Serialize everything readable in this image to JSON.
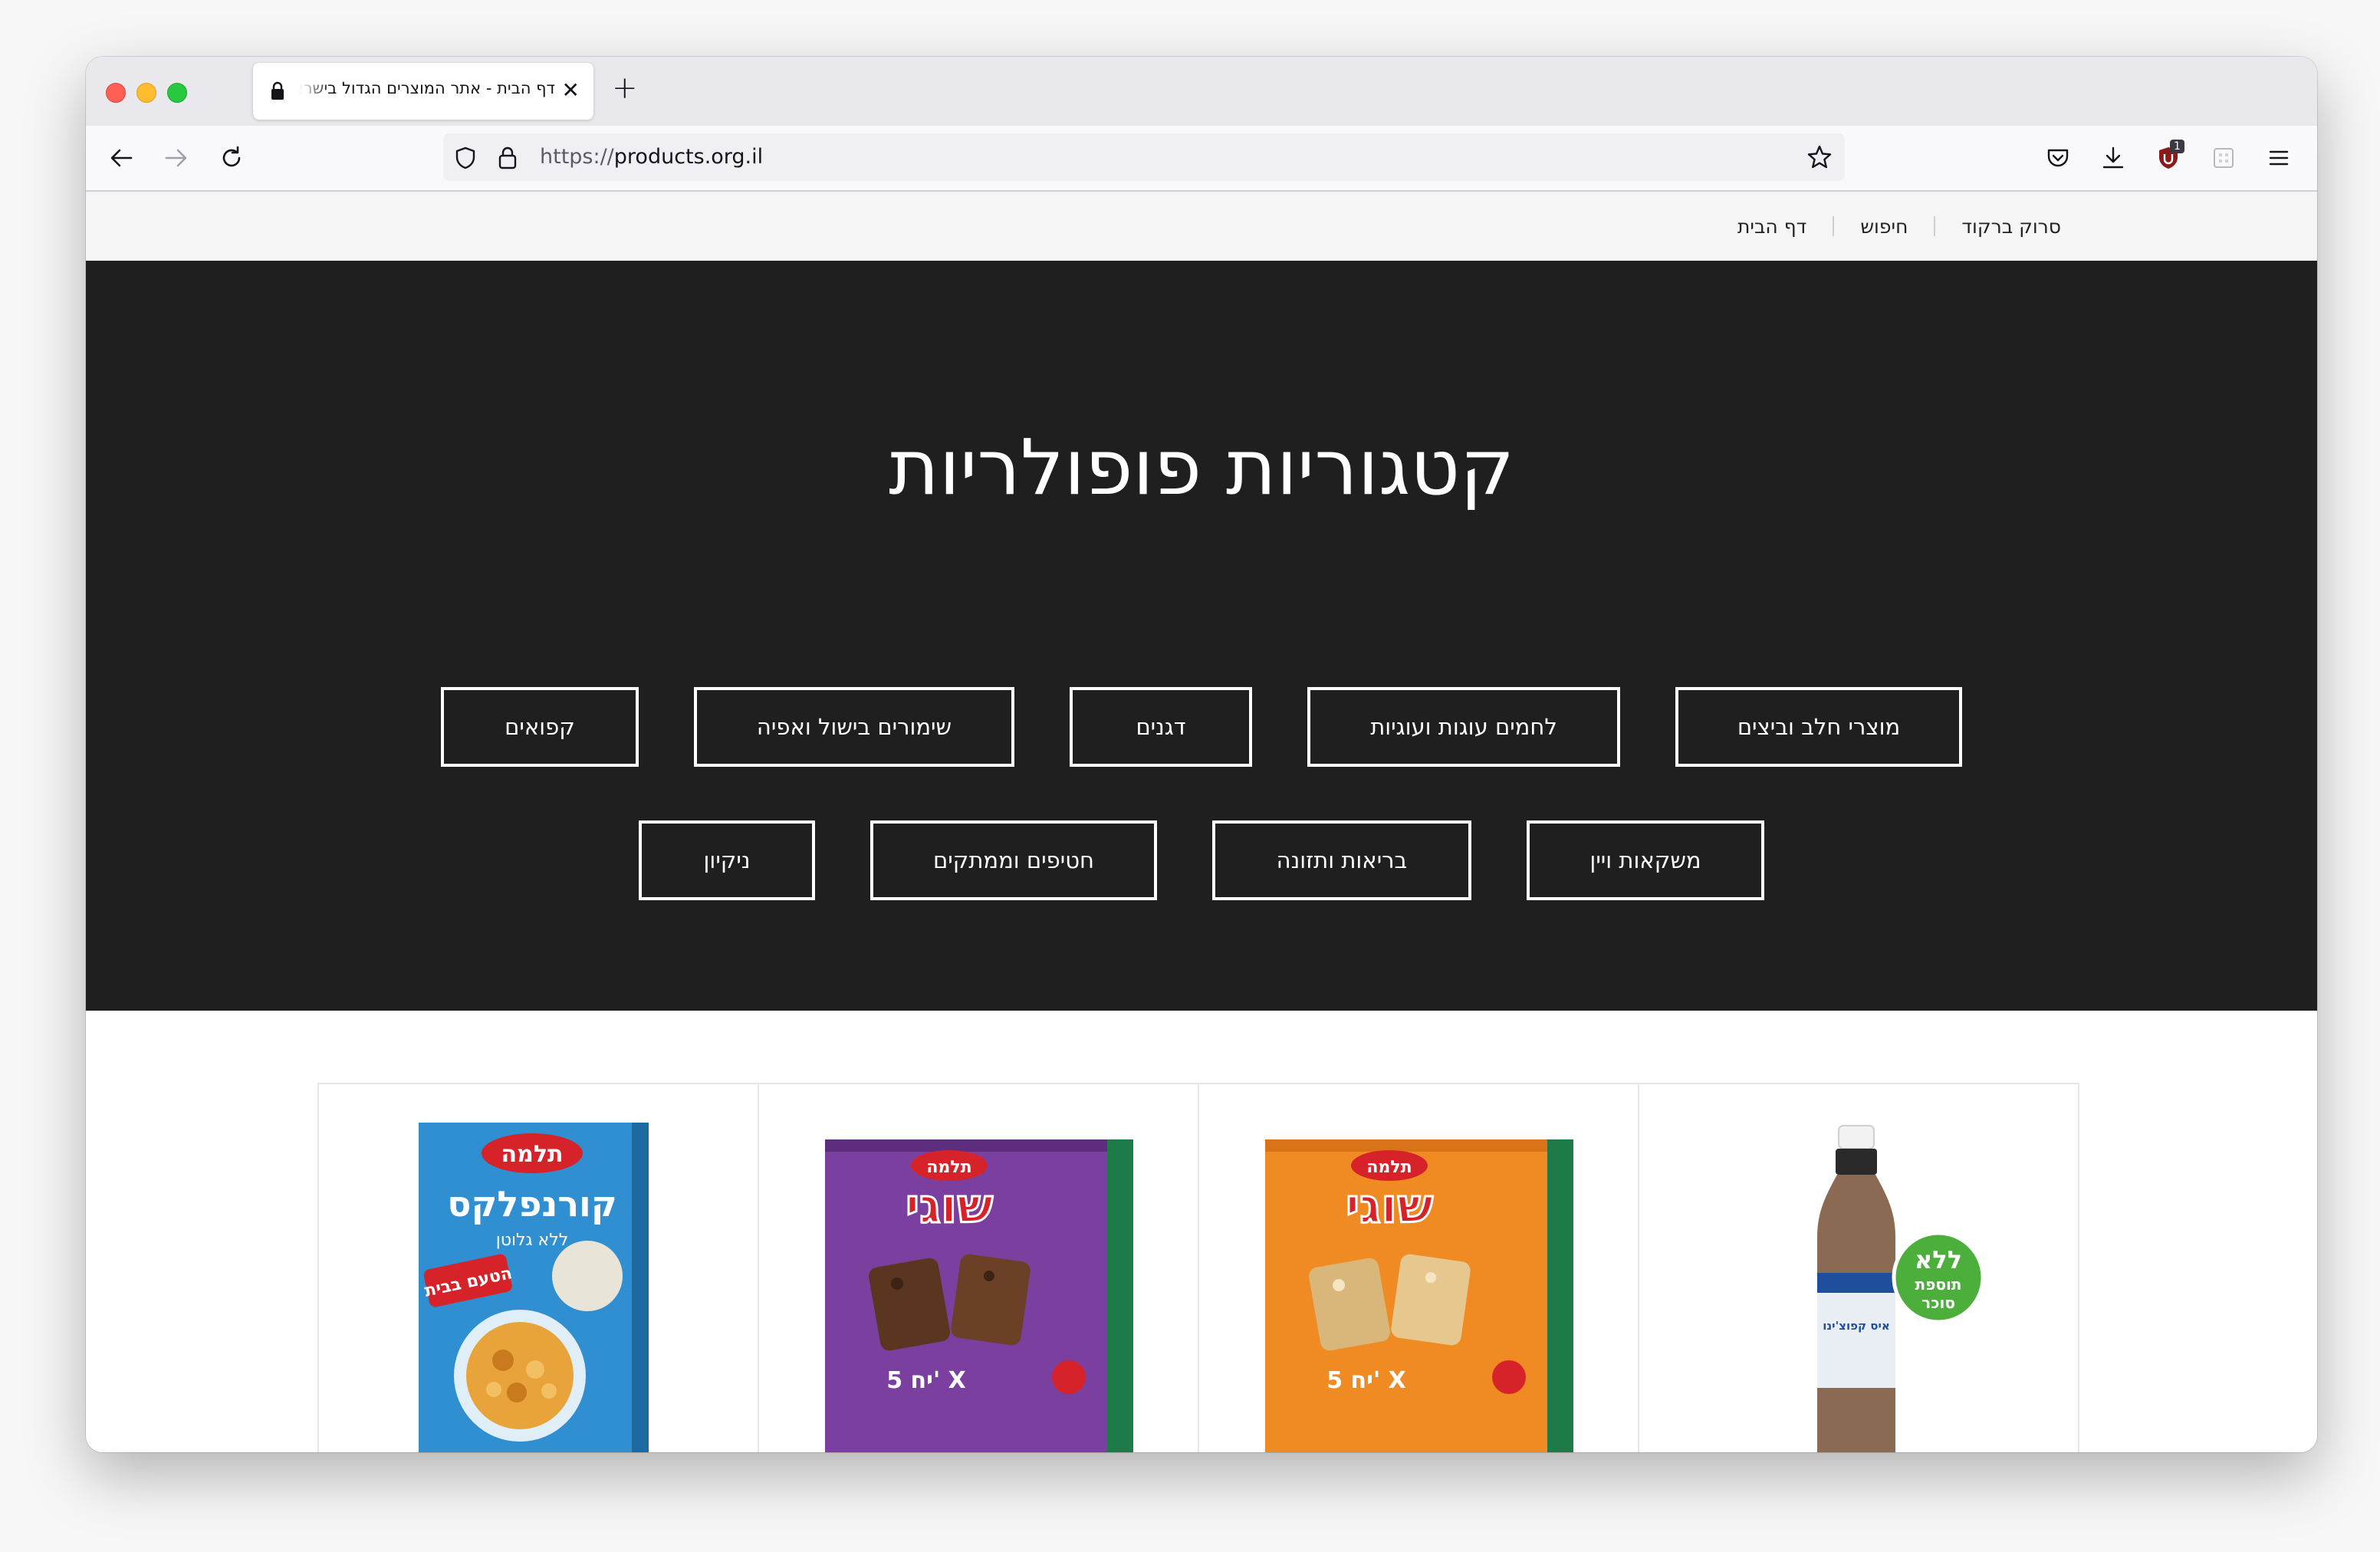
{
  "browser": {
    "tab_title": "דף הבית - אתר המוצרים הגדול בישראל",
    "url_scheme": "https://",
    "url_host": "products.org.il",
    "extension_badge": "1"
  },
  "site_nav": {
    "items": [
      "דף הבית",
      "חיפוש",
      "סרוק ברקוד"
    ]
  },
  "hero": {
    "title": "קטגוריות פופולריות",
    "categories_row1": [
      "מוצרי חלב וביצים",
      "לחמים עוגות ועוגיות",
      "דגנים",
      "שימורים בישול ואפיה",
      "קפואים"
    ],
    "categories_row2": [
      "משקאות ויין",
      "בריאות ותזונה",
      "חטיפים וממתקים",
      "ניקיון"
    ]
  },
  "products": [
    {
      "brand": "תלמה",
      "name": "קורנפלקס",
      "subtitle": "ללא גלוטן",
      "label": "הטעם בבית",
      "colors": {
        "bg": "#2f8fd0",
        "accent": "#d6232a"
      }
    },
    {
      "brand": "תלמה",
      "name": "שוגי",
      "pack": "5 יח' X",
      "colors": {
        "bg": "#7b3fa0",
        "accent": "#d6232a",
        "side": "#1f7a4a"
      }
    },
    {
      "brand": "תלמה",
      "name": "שוגי",
      "pack": "5 יח' X",
      "colors": {
        "bg": "#f08a23",
        "accent": "#d6232a",
        "side": "#1f7a4a"
      }
    },
    {
      "brand": "",
      "name": "איס קפוצ'ינו",
      "badge_line1": "ללא",
      "badge_line2": "תוספת",
      "badge_line3": "סוכר",
      "colors": {
        "badge": "#4caf3c",
        "drink": "#8a6a52"
      }
    }
  ]
}
